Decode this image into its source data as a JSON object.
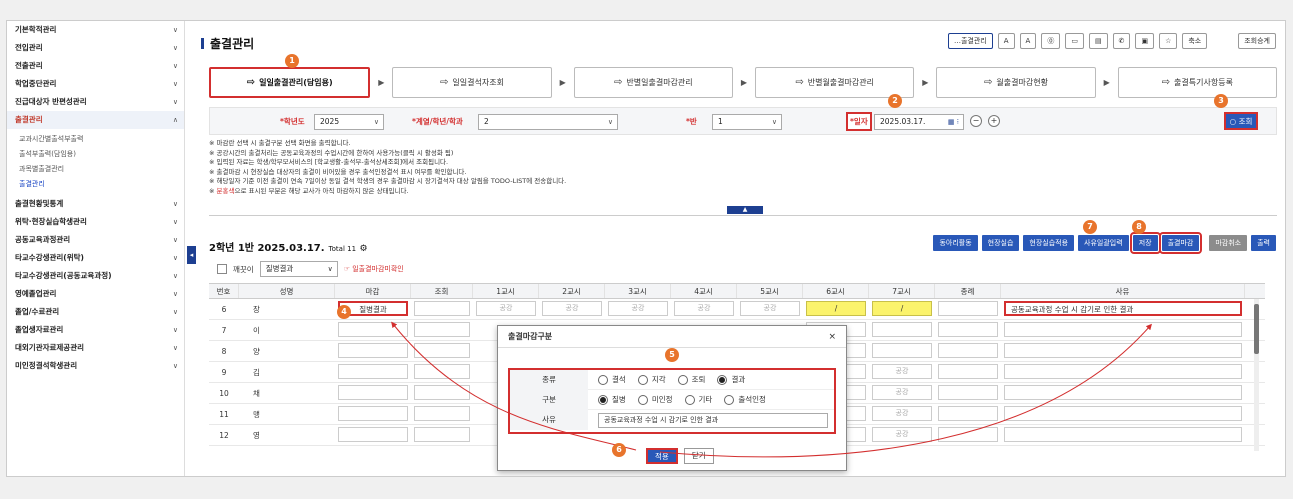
{
  "sidebar": {
    "items": [
      {
        "label": "기본학적관리"
      },
      {
        "label": "전입관리"
      },
      {
        "label": "전출관리"
      },
      {
        "label": "학업중단관리"
      },
      {
        "label": "진급대상자 반편성관리"
      },
      {
        "label": "출결관리",
        "active": true
      }
    ],
    "subitems": [
      {
        "label": "교과시간별출석부출력"
      },
      {
        "label": "출석부출력(담임용)"
      },
      {
        "label": "과목별출결관리"
      },
      {
        "label": "출결관리",
        "selected": true
      }
    ],
    "items2": [
      {
        "label": "출결현황및통계"
      },
      {
        "label": "위탁·현장실습학생관리"
      },
      {
        "label": "공동교육과정관리"
      },
      {
        "label": "타교수강생관리(위탁)"
      },
      {
        "label": "타교수강생관리(공동교육과정)"
      },
      {
        "label": "영예졸업관리"
      },
      {
        "label": "졸업/수료관리"
      },
      {
        "label": "졸업생자료관리"
      },
      {
        "label": "대외기관자료제공관리"
      },
      {
        "label": "미인정결석학생관리"
      }
    ]
  },
  "page": {
    "title": "출결관리"
  },
  "topbar": [
    "…출결관리",
    "A",
    "A",
    "⓪",
    "▭",
    "▤",
    "✆",
    "▣",
    "☆",
    "축소",
    "조회승계"
  ],
  "steps": [
    {
      "label": "일일출결관리(담임용)",
      "active": true
    },
    {
      "label": "일일결석자조회"
    },
    {
      "label": "반별일출결마감관리"
    },
    {
      "label": "반별월출결마감관리"
    },
    {
      "label": "월출결마감현황"
    },
    {
      "label": "출결특기사항등록"
    }
  ],
  "filter": {
    "year_label": "*학년도",
    "year": "2025",
    "class_label": "*계열/학년/학과",
    "grade": "2",
    "ban_label": "*반",
    "ban": "1",
    "date_label": "*일자",
    "date": "2025.03.17.",
    "search": "조회"
  },
  "notes": [
    "※ 마감란 선택 시 출결구분 선택 화면을 출력합니다.",
    "※ 공강시간의 출결처리는 공동교육과정의 수업시간에 한하여 사용가능(클릭 시 활성화 됨)",
    "※ 입력된 자료는 학생/학부모서비스의 [학교생활-출석부-출석상세조회]에서 조회됩니다.",
    "※ 출결마감 시 현장실습 대상자의 출결이 비어있을 경우 출석인정결석 표시 여부를 확인합니다.",
    "※ 해당일자 기준 이전 출결이 연속 7일이상 동일 결석 학생의 경우 출결마감 시 장기결석자 대상 알림을 TODO-LIST에 전송합니다.",
    "으로 표시된 부분은 해당 교사가 아직 마감하지 않은 상태입니다."
  ],
  "note_prefix": "※ ",
  "note_red": "분홍색",
  "grid": {
    "title": "2학년 1반 2025.03.17.",
    "total": "Total 11",
    "actions": [
      "동아리활동",
      "현장실습",
      "현장실습적용",
      "사유일괄입력",
      "저장",
      "출결마감",
      "마감취소",
      "출력"
    ],
    "clean_label": "깨끗이",
    "select_value": "질병결과",
    "warning": "☞ 일출결마감미확인",
    "headers": [
      "번호",
      "성명",
      "마감",
      "조회",
      "1교시",
      "2교시",
      "3교시",
      "4교시",
      "5교시",
      "6교시",
      "7교시",
      "종례",
      "사유"
    ],
    "rows": [
      {
        "no": "6",
        "name": "장",
        "close": "질병결과",
        "p6": "/",
        "p7": "/",
        "reason": "공동교육과정 수업 시 감기로 인한 결과"
      },
      {
        "no": "7",
        "name": "이"
      },
      {
        "no": "8",
        "name": "양"
      },
      {
        "no": "9",
        "name": "김"
      },
      {
        "no": "10",
        "name": "채"
      },
      {
        "no": "11",
        "name": "맹"
      },
      {
        "no": "12",
        "name": "영"
      }
    ],
    "gonggang": "공강"
  },
  "modal": {
    "title": "출결마감구분",
    "close": "×",
    "type_label": "종류",
    "type_options": [
      "결석",
      "지각",
      "조퇴",
      "결과"
    ],
    "type_selected": 3,
    "cat_label": "구분",
    "cat_options": [
      "질병",
      "미인정",
      "기타",
      "출석인정"
    ],
    "cat_selected": 0,
    "reason_label": "사유",
    "reason_value": "공동교육과정 수업 시 감기로 인한 결과",
    "apply": "적용",
    "close_btn": "닫기"
  },
  "badges": [
    "1",
    "2",
    "3",
    "4",
    "5",
    "6",
    "7",
    "8"
  ],
  "colors": {
    "accent": "#2958b8",
    "highlight": "#d32f2f",
    "badge": "#e8742c",
    "yellow": "#fbf36c"
  }
}
